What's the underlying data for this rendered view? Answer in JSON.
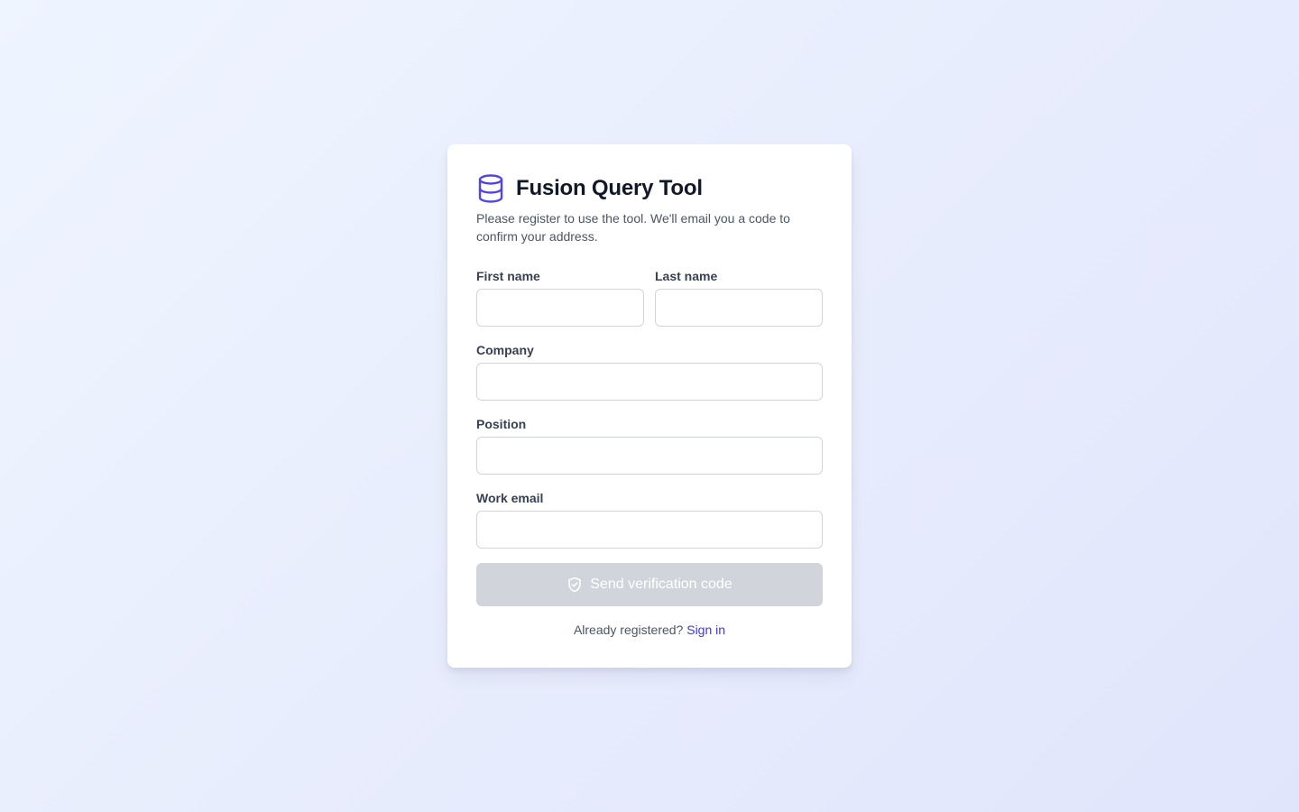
{
  "app": {
    "title": "Fusion Query Tool",
    "subtitle": "Please register to use the tool. We'll email you a code to confirm your address.",
    "icon": "database-icon",
    "accent_color": "#4f46e5"
  },
  "form": {
    "first_name_label": "First name",
    "first_name_value": "",
    "last_name_label": "Last name",
    "last_name_value": "",
    "company_label": "Company",
    "company_value": "",
    "position_label": "Position",
    "position_value": "",
    "email_label": "Work email",
    "email_value": "",
    "submit_label": "Send verification code",
    "submit_icon": "shield-check-icon",
    "submit_disabled": true
  },
  "footer": {
    "prompt": "Already registered?",
    "link": "Sign in"
  }
}
